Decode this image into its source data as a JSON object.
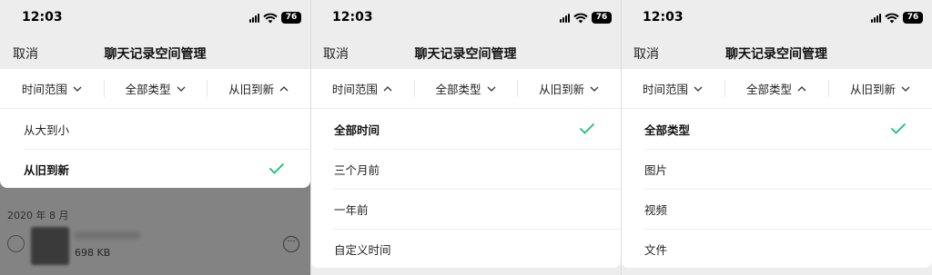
{
  "status_bar": {
    "time": "12:03",
    "battery": "76"
  },
  "nav": {
    "cancel": "取消",
    "title": "聊天记录空间管理"
  },
  "filters": {
    "time_range": "时间范围",
    "type": "全部类型",
    "order": "从旧到新"
  },
  "panels": [
    {
      "open_filter": "order",
      "options": [
        {
          "label": "从大到小",
          "selected": false
        },
        {
          "label": "从旧到新",
          "selected": true
        }
      ],
      "background": {
        "month": "2020 年 8 月",
        "file_size": "698 KB"
      }
    },
    {
      "open_filter": "time_range",
      "options": [
        {
          "label": "全部时间",
          "selected": true
        },
        {
          "label": "三个月前",
          "selected": false
        },
        {
          "label": "一年前",
          "selected": false
        },
        {
          "label": "自定义时间",
          "selected": false
        }
      ]
    },
    {
      "open_filter": "type",
      "options": [
        {
          "label": "全部类型",
          "selected": true
        },
        {
          "label": "图片",
          "selected": false
        },
        {
          "label": "视频",
          "selected": false
        },
        {
          "label": "文件",
          "selected": false
        }
      ]
    }
  ],
  "colors": {
    "check": "#07c160",
    "background": "#ededed",
    "surface": "#ffffff"
  },
  "icons": {
    "check": "checkmark-icon",
    "chevron_down": "chevron-down-icon",
    "chevron_up": "chevron-up-icon"
  }
}
